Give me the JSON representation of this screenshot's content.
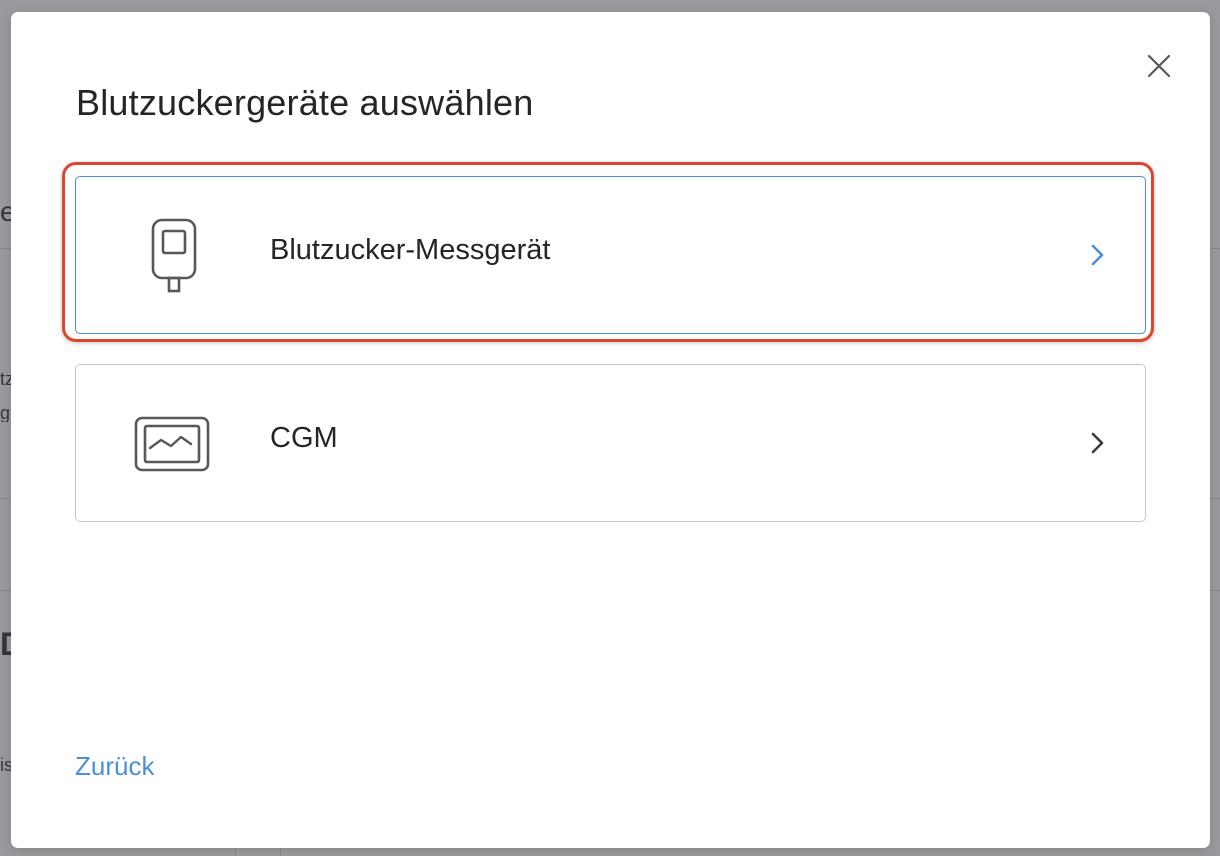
{
  "modal": {
    "title": "Blutzuckergeräte auswählen",
    "close_icon": "close-icon",
    "back_label": "Zurück"
  },
  "options": [
    {
      "label": "Blutzucker-Messgerät",
      "icon": "glucose-meter-icon",
      "chevron_icon": "chevron-right-icon",
      "highlighted": true
    },
    {
      "label": "CGM",
      "icon": "cgm-monitor-icon",
      "chevron_icon": "chevron-right-icon",
      "highlighted": false
    }
  ],
  "background_fragments": [
    "e",
    "tz",
    "g",
    "D",
    "is"
  ],
  "colors": {
    "accent": "#4a8fd8",
    "highlight_ring": "#e0442e",
    "text": "#232527",
    "card_border": "#c3c5c8",
    "icon_stroke": "#55585c"
  }
}
